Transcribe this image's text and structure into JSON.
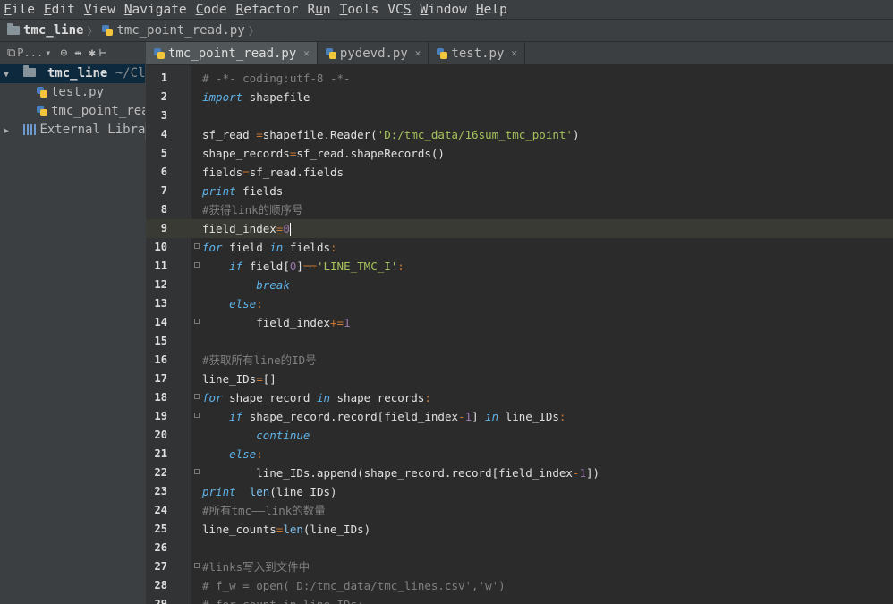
{
  "menu": [
    "File",
    "Edit",
    "View",
    "Navigate",
    "Code",
    "Refactor",
    "Run",
    "Tools",
    "VCS",
    "Window",
    "Help"
  ],
  "menu_mnemonics": [
    "F",
    "E",
    "V",
    "N",
    "C",
    "R",
    "u",
    "T",
    "S",
    "W",
    "H"
  ],
  "breadcrumb": {
    "project": "tmc_line",
    "file": "tmc_point_read.py"
  },
  "project_toolbar": {
    "label": "P...",
    "dropdown": "▾"
  },
  "tree": {
    "root": "tmc_line",
    "root_path": "~/Clo",
    "files": [
      "test.py",
      "tmc_point_rea"
    ],
    "external": "External Libraries"
  },
  "tabs": [
    {
      "label": "tmc_point_read.py",
      "active": true
    },
    {
      "label": "pydevd.py",
      "active": false
    },
    {
      "label": "test.py",
      "active": false
    }
  ],
  "code_lines": [
    {
      "n": "1",
      "html": "<span class='cm'># -*- coding:utf-8 -*-</span>"
    },
    {
      "n": "2",
      "html": "<span class='kw'>import</span> shapefile"
    },
    {
      "n": "3",
      "html": ""
    },
    {
      "n": "4",
      "html": "sf_read <span class='op'>=</span>shapefile.Reader(<span class='str'>'D:/tmc_data/16sum_tmc_point'</span>)"
    },
    {
      "n": "5",
      "html": "shape_records<span class='op'>=</span>sf_read.shapeRecords()"
    },
    {
      "n": "6",
      "html": "fields<span class='op'>=</span>sf_read.fields"
    },
    {
      "n": "7",
      "html": "<span class='kw'>print</span> fields"
    },
    {
      "n": "8",
      "html": "<span class='cm'>#获得link的顺序号</span>"
    },
    {
      "n": "9",
      "html": "field_index<span class='op'>=</span><span class='num'>0</span><span class='caret'></span>",
      "current": true
    },
    {
      "n": "10",
      "html": "<span class='kw'>for</span> field <span class='kw'>in</span> fields<span class='op'>:</span>",
      "fold": true
    },
    {
      "n": "11",
      "html": "    <span class='kw'>if</span> field[<span class='num'>0</span>]<span class='op'>==</span><span class='str'>'LINE_TMC_I'</span><span class='op'>:</span>",
      "fold": true
    },
    {
      "n": "12",
      "html": "        <span class='kw'>break</span>"
    },
    {
      "n": "13",
      "html": "    <span class='kw'>else</span><span class='op'>:</span>"
    },
    {
      "n": "14",
      "html": "        field_index<span class='op'>+=</span><span class='num'>1</span>",
      "fold": true
    },
    {
      "n": "15",
      "html": ""
    },
    {
      "n": "16",
      "html": "<span class='cm'>#获取所有line的ID号</span>"
    },
    {
      "n": "17",
      "html": "line_IDs<span class='op'>=</span>[]"
    },
    {
      "n": "18",
      "html": "<span class='kw'>for</span> shape_record <span class='kw'>in</span> shape_records<span class='op'>:</span>",
      "fold": true
    },
    {
      "n": "19",
      "html": "    <span class='kw'>if</span> shape_record.record[field_index<span class='op'>-</span><span class='num'>1</span>] <span class='kw'>in</span> line_IDs<span class='op'>:</span>",
      "fold": true
    },
    {
      "n": "20",
      "html": "        <span class='kw'>continue</span>"
    },
    {
      "n": "21",
      "html": "    <span class='kw'>else</span><span class='op'>:</span>"
    },
    {
      "n": "22",
      "html": "        line_IDs.append(shape_record.record[field_index<span class='op'>-</span><span class='num'>1</span>])",
      "fold": true
    },
    {
      "n": "23",
      "html": "<span class='kw'>print</span>  <span class='bi'>len</span>(line_IDs)"
    },
    {
      "n": "24",
      "html": "<span class='cm'>#所有tmc——link的数量</span>"
    },
    {
      "n": "25",
      "html": "line_counts<span class='op'>=</span><span class='bi'>len</span>(line_IDs)"
    },
    {
      "n": "26",
      "html": ""
    },
    {
      "n": "27",
      "html": "<span class='cm'>#links写入到文件中</span>",
      "fold": true
    },
    {
      "n": "28",
      "html": "<span class='cm'># f_w = open('D:/tmc_data/tmc_lines.csv','w')</span>"
    },
    {
      "n": "29",
      "html": "<span class='cm'># for count in line_IDs:</span>"
    }
  ]
}
